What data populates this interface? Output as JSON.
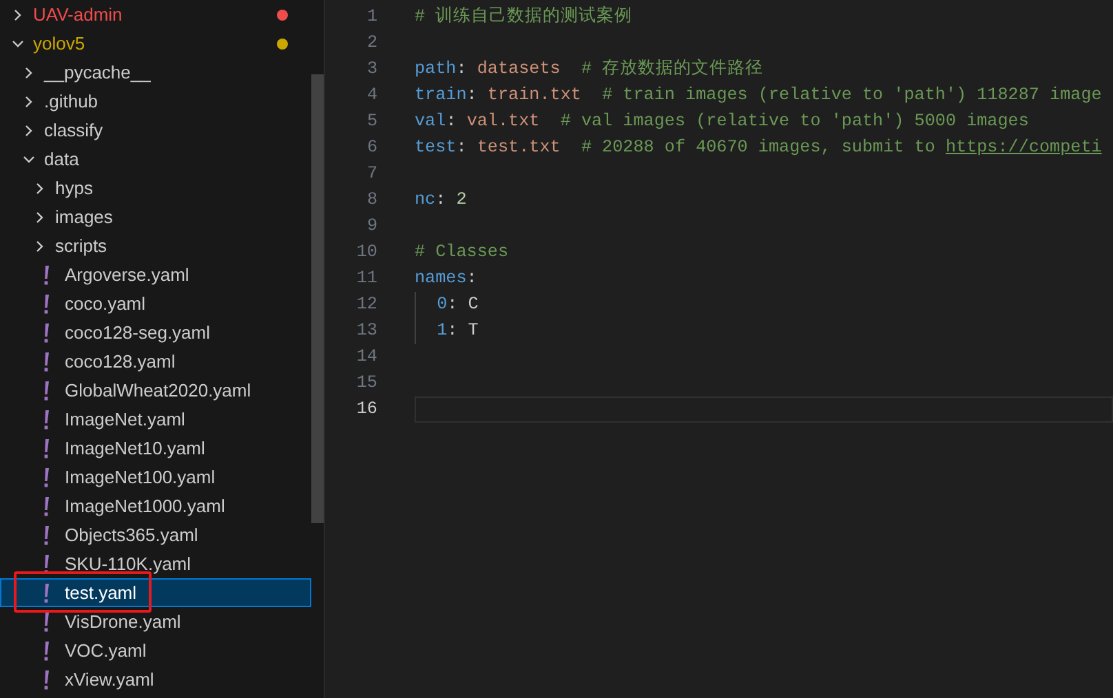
{
  "explorer": {
    "tree": [
      {
        "kind": "folder",
        "label": "UAV-admin",
        "expanded": false,
        "color": "#f14c4c"
      },
      {
        "kind": "folder",
        "label": "yolov5",
        "expanded": true,
        "color": "#cca700",
        "children": [
          {
            "kind": "folder",
            "label": "__pycache__",
            "expanded": false
          },
          {
            "kind": "folder",
            "label": ".github",
            "expanded": false
          },
          {
            "kind": "folder",
            "label": "classify",
            "expanded": false
          },
          {
            "kind": "folder",
            "label": "data",
            "expanded": true,
            "children": [
              {
                "kind": "folder",
                "label": "hyps",
                "expanded": false
              },
              {
                "kind": "folder",
                "label": "images",
                "expanded": false
              },
              {
                "kind": "folder",
                "label": "scripts",
                "expanded": false
              },
              {
                "kind": "file",
                "label": "Argoverse.yaml",
                "selected": false
              },
              {
                "kind": "file",
                "label": "coco.yaml",
                "selected": false
              },
              {
                "kind": "file",
                "label": "coco128-seg.yaml",
                "selected": false
              },
              {
                "kind": "file",
                "label": "coco128.yaml",
                "selected": false
              },
              {
                "kind": "file",
                "label": "GlobalWheat2020.yaml",
                "selected": false
              },
              {
                "kind": "file",
                "label": "ImageNet.yaml",
                "selected": false
              },
              {
                "kind": "file",
                "label": "ImageNet10.yaml",
                "selected": false
              },
              {
                "kind": "file",
                "label": "ImageNet100.yaml",
                "selected": false
              },
              {
                "kind": "file",
                "label": "ImageNet1000.yaml",
                "selected": false
              },
              {
                "kind": "file",
                "label": "Objects365.yaml",
                "selected": false
              },
              {
                "kind": "file",
                "label": "SKU-110K.yaml",
                "selected": false
              },
              {
                "kind": "file",
                "label": "test.yaml",
                "selected": true,
                "annotated": true
              },
              {
                "kind": "file",
                "label": "VisDrone.yaml",
                "selected": false
              },
              {
                "kind": "file",
                "label": "VOC.yaml",
                "selected": false
              },
              {
                "kind": "file",
                "label": "xView.yaml",
                "selected": false
              }
            ]
          }
        ]
      }
    ]
  },
  "editor": {
    "lines": [
      {
        "number": "1",
        "current": false,
        "tokens": [
          {
            "kind": "comment",
            "text": "# 训练自己数据的测试案例"
          }
        ]
      },
      {
        "number": "2",
        "current": false
      },
      {
        "number": "3",
        "current": false,
        "tokens": [
          {
            "kind": "key",
            "text": "path"
          },
          {
            "kind": "plain",
            "text": ": "
          },
          {
            "kind": "string",
            "text": "datasets"
          },
          {
            "kind": "comment",
            "text": "# 存放数据的文件路径"
          }
        ]
      },
      {
        "number": "4",
        "current": false,
        "tokens": [
          {
            "kind": "key",
            "text": "train"
          },
          {
            "kind": "plain",
            "text": ": "
          },
          {
            "kind": "string",
            "text": "train.txt"
          },
          {
            "kind": "comment",
            "text": "# train images (relative to 'path') 118287 image"
          }
        ]
      },
      {
        "number": "5",
        "current": false,
        "tokens": [
          {
            "kind": "key",
            "text": "val"
          },
          {
            "kind": "plain",
            "text": ": "
          },
          {
            "kind": "string",
            "text": "val.txt"
          },
          {
            "kind": "comment",
            "text": "# val images (relative to 'path') 5000 images"
          }
        ]
      },
      {
        "number": "6",
        "current": false,
        "tokens": [
          {
            "kind": "key",
            "text": "test"
          },
          {
            "kind": "plain",
            "text": ": "
          },
          {
            "kind": "string",
            "text": "test.txt"
          },
          {
            "kind": "comment",
            "text": "# 20288 of 40670 images, submit to "
          },
          {
            "kind": "link",
            "text": "https://competi"
          }
        ]
      },
      {
        "number": "7",
        "current": false
      },
      {
        "number": "8",
        "current": false,
        "tokens": [
          {
            "kind": "key",
            "text": "nc"
          },
          {
            "kind": "plain",
            "text": ": "
          },
          {
            "kind": "number",
            "text": "2"
          }
        ]
      },
      {
        "number": "9",
        "current": false
      },
      {
        "number": "10",
        "current": false,
        "tokens": [
          {
            "kind": "comment",
            "text": "# Classes"
          }
        ]
      },
      {
        "number": "11",
        "current": false,
        "tokens": [
          {
            "kind": "key",
            "text": "names"
          },
          {
            "kind": "plain",
            "text": ":"
          }
        ]
      },
      {
        "number": "12",
        "current": false,
        "indented": true,
        "tokens": [
          {
            "kind": "key",
            "text": "0"
          },
          {
            "kind": "plain",
            "text": ": C"
          }
        ]
      },
      {
        "number": "13",
        "current": false,
        "indented": true,
        "tokens": [
          {
            "kind": "key",
            "text": "1"
          },
          {
            "kind": "plain",
            "text": ": T"
          }
        ]
      },
      {
        "number": "14",
        "current": false
      },
      {
        "number": "15",
        "current": false
      },
      {
        "number": "16",
        "current": true
      }
    ]
  }
}
